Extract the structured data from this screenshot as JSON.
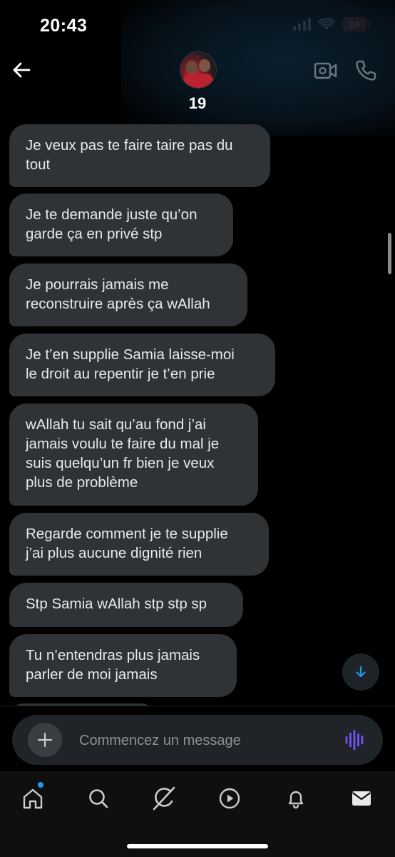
{
  "status_bar": {
    "time": "20:43",
    "battery_level": "14",
    "battery_color": "#e5393c",
    "icons": [
      "signal-bars-icon",
      "wifi-icon",
      "battery-icon"
    ]
  },
  "header": {
    "title": "19",
    "back_icon": "arrow-left-icon",
    "video_icon": "video-camera-icon",
    "call_icon": "phone-icon"
  },
  "messages": [
    {
      "lines": [
        "Je veux pas te faire taire pas du",
        "tout"
      ]
    },
    {
      "lines": [
        "Je te demande juste qu’on",
        "garde ça en privé stp"
      ]
    },
    {
      "lines": [
        "Je pourrais jamais me",
        "reconstruire après ça wAllah"
      ]
    },
    {
      "lines": [
        "Je t’en supplie Samia laisse-moi",
        "le droit au repentir je t’en prie"
      ]
    },
    {
      "lines": [
        "wAllah tu sait qu’au fond j’ai",
        "jamais voulu te faire du mal je",
        "suis quelqu’un fr bien je veux",
        "plus de problème"
      ]
    },
    {
      "lines": [
        "Regarde comment je te supplie",
        "j’ai plus aucune dignité rien"
      ]
    },
    {
      "lines": [
        "Stp Samia wAllah stp stp sp"
      ]
    },
    {
      "lines": [
        "Tu n’entendras plus jamais",
        "parler de moi jamais"
      ]
    }
  ],
  "scroll_down_icon": "arrow-down-icon",
  "composer": {
    "placeholder": "Commencez un message",
    "add_icon": "plus-icon",
    "voice_icon": "voice-waveform-icon",
    "voice_color": "#7856ff"
  },
  "tabbar": {
    "tabs": [
      "home-icon",
      "search-icon",
      "grok-icon",
      "play-icon",
      "bell-icon",
      "mail-icon"
    ],
    "notification_dot_color": "#1d9bf0"
  }
}
